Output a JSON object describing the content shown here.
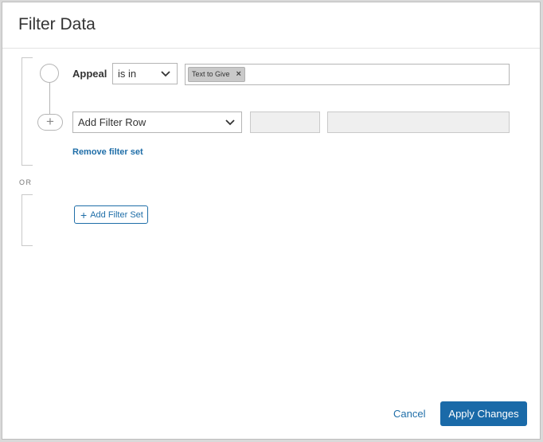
{
  "modal": {
    "title": "Filter Data"
  },
  "filter_sets": [
    {
      "rows": [
        {
          "field": "Appeal",
          "operator": "is in",
          "values": [
            "Text to Give"
          ]
        }
      ],
      "add_row": {
        "placeholder": "Add Filter Row"
      },
      "remove_label": "Remove filter set"
    }
  ],
  "or_label": "OR",
  "add_filter_set_label": "Add Filter Set",
  "footer": {
    "cancel_label": "Cancel",
    "apply_label": "Apply Changes"
  },
  "icons": {
    "add_row": "plus-icon",
    "tag_remove": "close-icon",
    "dropdown": "chevron-down-icon"
  },
  "colors": {
    "accent": "#1a6aa8",
    "link": "#1f6ea8"
  }
}
